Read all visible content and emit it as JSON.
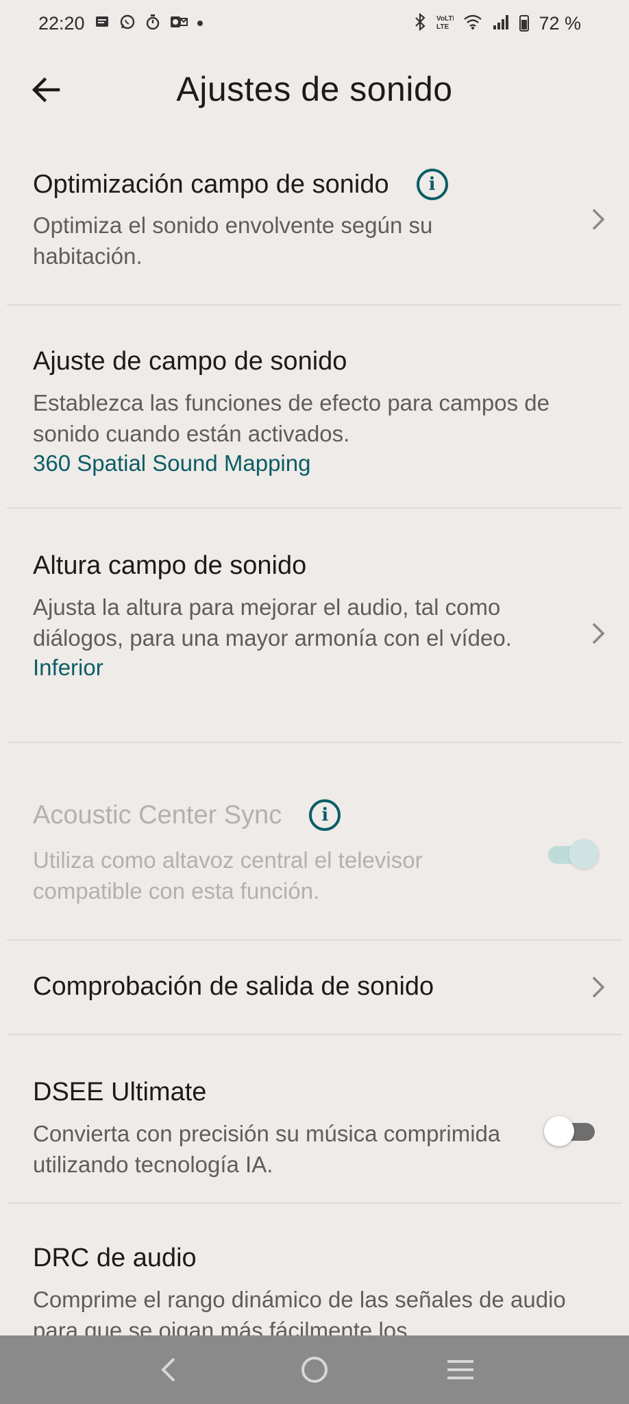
{
  "status_bar": {
    "time": "22:20",
    "battery": "72 %",
    "left_icons": [
      "message-icon",
      "whatsapp-icon",
      "timer-icon",
      "outlook-icon"
    ],
    "right_icons": [
      "bluetooth-icon",
      "volte-icon",
      "wifi-icon",
      "signal-icon",
      "battery-icon"
    ]
  },
  "header": {
    "title": "Ajustes de sonido"
  },
  "settings": {
    "optimizacion": {
      "title": "Optimización campo de sonido",
      "desc": "Optimiza el sonido envolvente según su habitación."
    },
    "ajuste": {
      "title": "Ajuste de campo de sonido",
      "desc": "Establezca las funciones de efecto para campos de sonido cuando están activados.",
      "value": "360 Spatial Sound Mapping"
    },
    "altura": {
      "title": "Altura campo de sonido",
      "desc": "Ajusta la altura para mejorar el audio, tal como diálogos, para una mayor armonía con el vídeo.",
      "value": "Inferior"
    },
    "acoustic": {
      "title": "Acoustic Center Sync",
      "desc": "Utiliza como altavoz central el televisor compatible con esta función.",
      "enabled": true,
      "disabled": true
    },
    "comprobacion": {
      "title": "Comprobación de salida de sonido"
    },
    "dsee": {
      "title": "DSEE Ultimate",
      "desc": "Convierta con precisión su música comprimida utilizando tecnología IA.",
      "enabled": false
    },
    "drc": {
      "title": "DRC de audio",
      "desc": "Comprime el rango dinámico de las señales de audio para que se oigan más fácilmente los"
    }
  },
  "colors": {
    "background": "#efebe8",
    "accent": "#0b5d66",
    "nav_bar": "#8a8a8a"
  }
}
